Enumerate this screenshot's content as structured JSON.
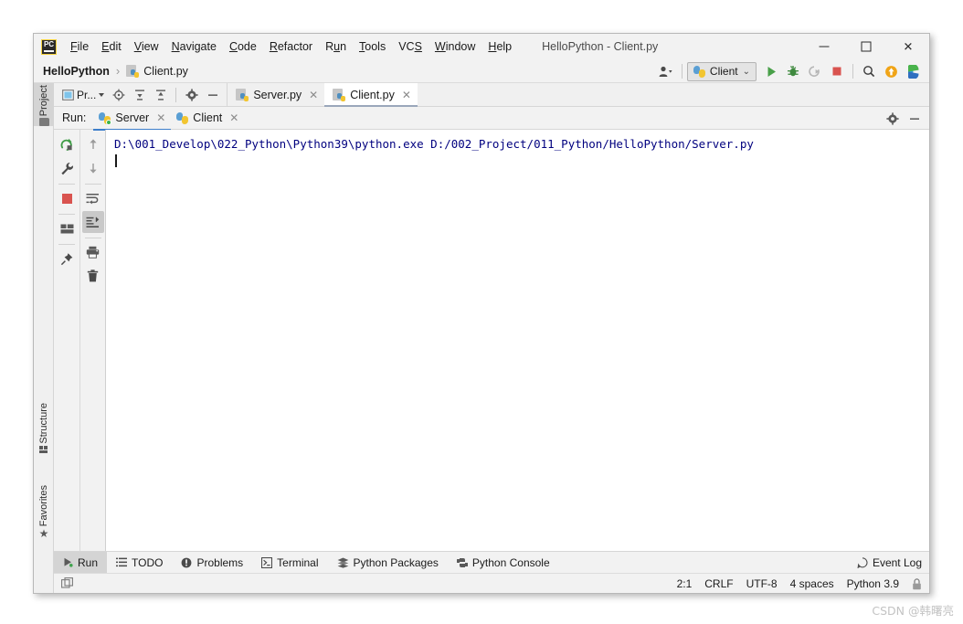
{
  "window": {
    "title": "HelloPython - Client.py",
    "app_icon": "pycharm-logo-icon",
    "controls": {
      "minimize": "minimize-icon",
      "maximize": "maximize-icon",
      "close": "✕"
    }
  },
  "menubar": {
    "items": [
      {
        "label": "File",
        "mnemonic": "F"
      },
      {
        "label": "Edit",
        "mnemonic": "E"
      },
      {
        "label": "View",
        "mnemonic": "V"
      },
      {
        "label": "Navigate",
        "mnemonic": "N"
      },
      {
        "label": "Code",
        "mnemonic": "C"
      },
      {
        "label": "Refactor",
        "mnemonic": "R"
      },
      {
        "label": "Run",
        "mnemonic": "u"
      },
      {
        "label": "Tools",
        "mnemonic": "T"
      },
      {
        "label": "VCS",
        "mnemonic": "S"
      },
      {
        "label": "Window",
        "mnemonic": "W"
      },
      {
        "label": "Help",
        "mnemonic": "H"
      }
    ]
  },
  "navbar": {
    "project": "HelloPython",
    "separator": "›",
    "file": "Client.py",
    "file_icon": "python-file-icon",
    "toolbar": {
      "user_icon": "user-settings-icon",
      "run_config": {
        "label": "Client",
        "icon": "python-icon",
        "chevron": "⌄"
      },
      "run_icon": "run-icon",
      "debug_icon": "debug-icon",
      "run_coverage_icon": "run-with-coverage-icon",
      "stop_icon": "stop-icon",
      "search_icon": "search-everywhere-icon",
      "update_icon": "update-project-icon",
      "profile_icon": "profile-icon"
    }
  },
  "left_strip": {
    "items": [
      {
        "label": "Project",
        "icon": "folder-icon",
        "selected": true
      },
      {
        "label": "Structure",
        "icon": "structure-icon",
        "selected": false
      },
      {
        "label": "Favorites",
        "icon": "star-icon",
        "selected": false
      }
    ]
  },
  "project_tools": {
    "view_selector": {
      "label": "Pr...",
      "icon": "project-view-icon",
      "caret": "▾"
    },
    "locate_icon": "locate-file-icon",
    "expand_icon": "expand-all-icon",
    "collapse_icon": "collapse-all-icon",
    "settings_icon": "gear-icon",
    "hide_icon": "hide-panel-icon"
  },
  "editor_tabs": [
    {
      "label": "Server.py",
      "icon": "python-file-icon",
      "active": false,
      "close": "✕"
    },
    {
      "label": "Client.py",
      "icon": "python-file-icon",
      "active": true,
      "close": "✕"
    }
  ],
  "run_window": {
    "title": "Run:",
    "tabs": [
      {
        "label": "Server",
        "icon": "python-icon",
        "active": true,
        "running": true,
        "close": "✕"
      },
      {
        "label": "Client",
        "icon": "python-icon",
        "active": false,
        "running": false,
        "close": "✕"
      }
    ],
    "header_actions": {
      "settings_icon": "gear-icon",
      "minimize_icon": "minimize-panel-icon"
    },
    "left_actions": [
      {
        "name": "rerun-icon",
        "pressed": false
      },
      {
        "name": "wrench-icon",
        "pressed": false
      },
      {
        "name": "stop-icon",
        "pressed": false
      },
      {
        "name": "layout-icon",
        "pressed": false
      },
      {
        "name": "pin-icon",
        "pressed": false
      }
    ],
    "right_actions": [
      {
        "name": "up-arrow-icon",
        "pressed": false
      },
      {
        "name": "down-arrow-icon",
        "pressed": false
      },
      {
        "name": "soft-wrap-icon",
        "pressed": false
      },
      {
        "name": "scroll-to-end-icon",
        "pressed": true
      },
      {
        "name": "print-icon",
        "pressed": false
      },
      {
        "name": "clear-all-icon",
        "pressed": false
      }
    ],
    "console_text": "D:\\001_Develop\\022_Python\\Python39\\python.exe D:/002_Project/011_Python/HelloPython/Server.py"
  },
  "bottom_bar": {
    "tabs": [
      {
        "label": "Run",
        "icon": "run-icon",
        "active": true
      },
      {
        "label": "TODO",
        "icon": "todo-icon",
        "active": false
      },
      {
        "label": "Problems",
        "icon": "problems-icon",
        "active": false
      },
      {
        "label": "Terminal",
        "icon": "terminal-icon",
        "active": false
      },
      {
        "label": "Python Packages",
        "icon": "packages-icon",
        "active": false
      },
      {
        "label": "Python Console",
        "icon": "python-console-icon",
        "active": false
      }
    ],
    "event_log": {
      "label": "Event Log",
      "icon": "event-log-icon"
    }
  },
  "status_bar": {
    "layout_icon": "layout-toggle-icon",
    "items": [
      {
        "label": "2:1",
        "name": "caret-position"
      },
      {
        "label": "CRLF",
        "name": "line-separator"
      },
      {
        "label": "UTF-8",
        "name": "file-encoding"
      },
      {
        "label": "4 spaces",
        "name": "indent-setting"
      },
      {
        "label": "Python 3.9",
        "name": "interpreter"
      }
    ],
    "lock_icon": "lock-icon"
  },
  "watermark": "CSDN @韩曙亮",
  "colors": {
    "window_bg": "#f2f2f2",
    "console_bg": "#ffffff",
    "console_text": "#00007f",
    "active_tab_underline": "#3d7ecb",
    "run_green": "#3cb44a",
    "stop_red": "#d9534f"
  }
}
